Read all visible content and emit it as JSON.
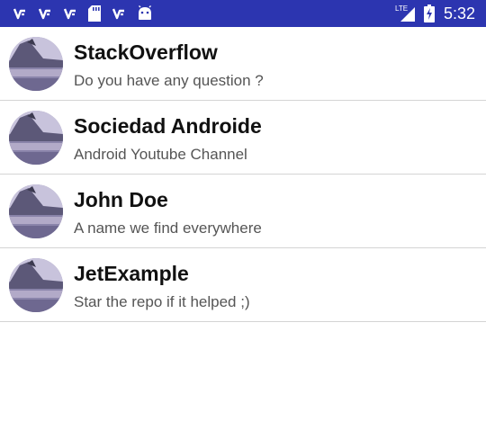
{
  "status_bar": {
    "background": "#2c35b0",
    "left_icons": [
      "carrier-v-icon",
      "carrier-v-icon",
      "carrier-v-icon",
      "sd-card-icon",
      "carrier-v-icon",
      "android-icon"
    ],
    "network_label": "LTE",
    "right_icons": [
      "signal-icon",
      "battery-charging-icon"
    ],
    "time": "5:32"
  },
  "contacts": [
    {
      "name": "StackOverflow",
      "description": "Do you have any question ?"
    },
    {
      "name": "Sociedad Androide",
      "description": "Android Youtube Channel"
    },
    {
      "name": "John Doe",
      "description": "A name we find everywhere"
    },
    {
      "name": "JetExample",
      "description": "Star the repo if it helped ;)"
    }
  ]
}
